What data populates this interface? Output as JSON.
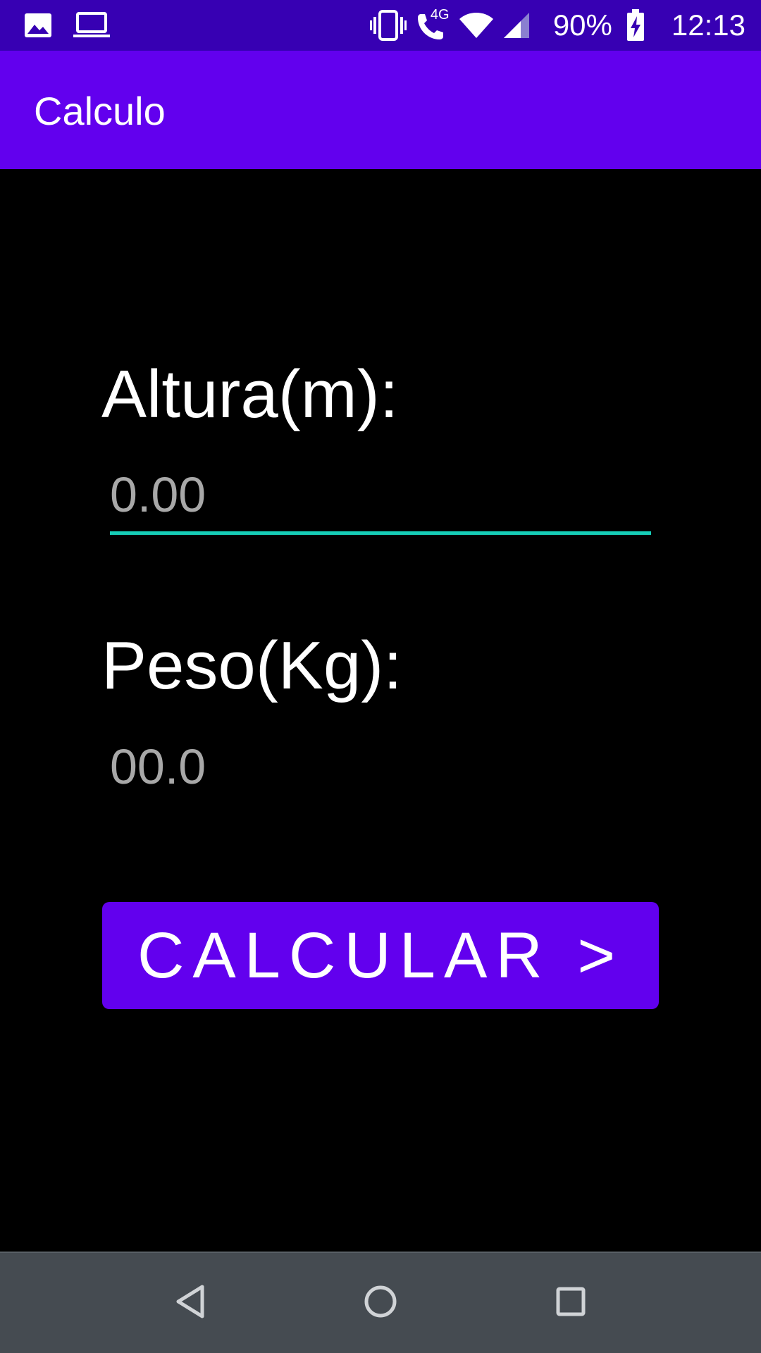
{
  "status_bar": {
    "left_icons": [
      "image-icon",
      "laptop-icon"
    ],
    "right_icons": [
      "vibrate-icon",
      "wifi-calling-icon",
      "wifi-icon",
      "signal-icon",
      "battery-charging-icon"
    ],
    "network_label": "4G",
    "battery_percent": "90%",
    "time": "12:13",
    "background_color": "#3700b3"
  },
  "app_bar": {
    "title": "Calculo",
    "background_color": "#6200ee"
  },
  "form": {
    "altura_label": "Altura(m):",
    "altura_placeholder": "0.00",
    "peso_label": "Peso(Kg):",
    "peso_placeholder": "00.0",
    "focus_underline_color": "#16cdb7"
  },
  "button": {
    "label": "CALCULAR >",
    "color": "#6200ee"
  },
  "nav_bar": {
    "buttons": [
      "back-icon",
      "home-icon",
      "recents-icon"
    ],
    "background_color": "#454b51"
  }
}
